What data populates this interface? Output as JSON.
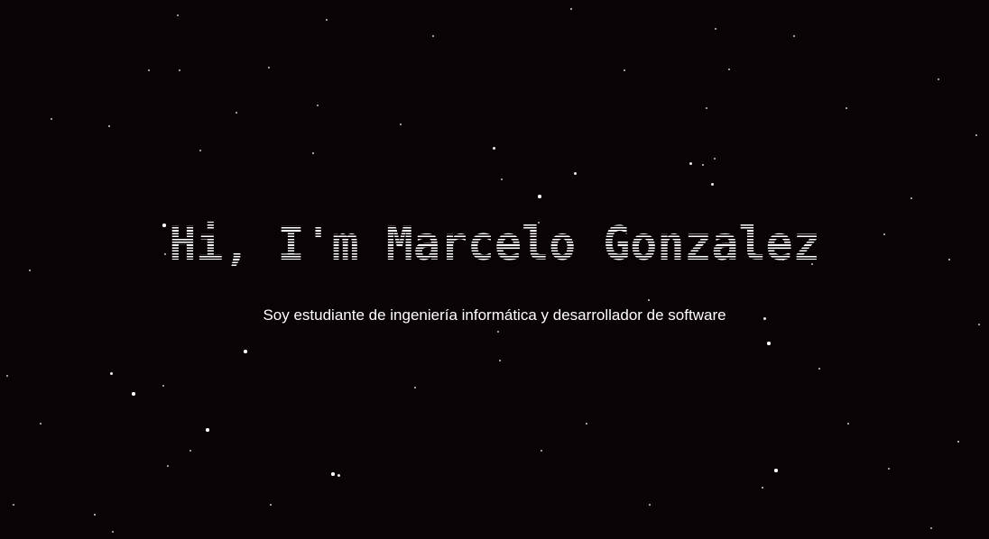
{
  "hero": {
    "title": "Hi, I'm Marcelo Gonzalez",
    "subtitle": "Soy estudiante de ingeniería informática y desarrollador de software"
  },
  "theme": {
    "background": "#0a0305",
    "text": "#ffffff",
    "star": "#ffffff"
  }
}
